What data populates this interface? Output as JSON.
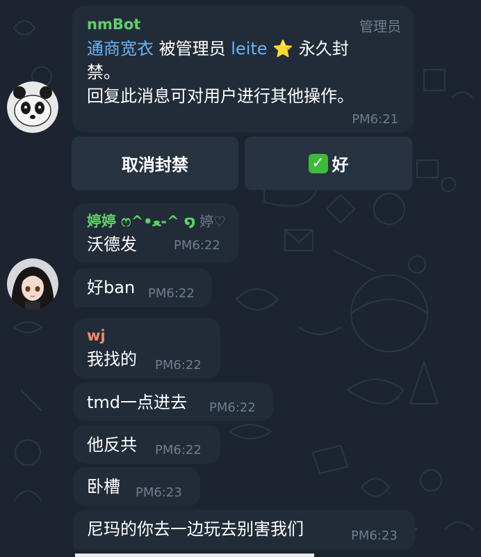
{
  "messages": [
    {
      "sender": "nmBot",
      "role": "管理员",
      "line1_user": "通商宽衣",
      "line1_mid": " 被管理员 ",
      "line1_admin": "leite",
      "line1_star": "⭐",
      "line1_end": " 永久封",
      "line2": "禁。",
      "line3": "回复此消息可对用户进行其他操作。",
      "time": "PM6:21"
    },
    {
      "sender": "婷婷 ෆ^•ﻌ-^ ໑",
      "role": "婷♡",
      "text": "沃德发",
      "time": "PM6:22"
    },
    {
      "text": "好ban",
      "time": "PM6:22"
    },
    {
      "sender": "wj",
      "text": "我找的",
      "time": "PM6:22"
    },
    {
      "text": "tmd一点进去",
      "time": "PM6:22"
    },
    {
      "text": "他反共",
      "time": "PM6:22"
    },
    {
      "text": "卧槽",
      "time": "PM6:23"
    },
    {
      "text": "尼玛的你去一边玩去别害我们",
      "time": "PM6:23"
    }
  ],
  "keyboard": {
    "unban_label": "取消封禁",
    "check_icon": "✓",
    "ok_label": "好"
  },
  "colors": {
    "background": "#1b2430",
    "bubble": "#222c38",
    "nmbot_name": "#5fd068",
    "tingting_name": "#5fd068",
    "wj_name": "#f28c6a",
    "link": "#6ab3f3",
    "meta": "#6f7d8c"
  },
  "icons": {
    "nmbot_avatar": "panda-avatar-icon",
    "user_avatar": "anime-girl-avatar-icon"
  }
}
